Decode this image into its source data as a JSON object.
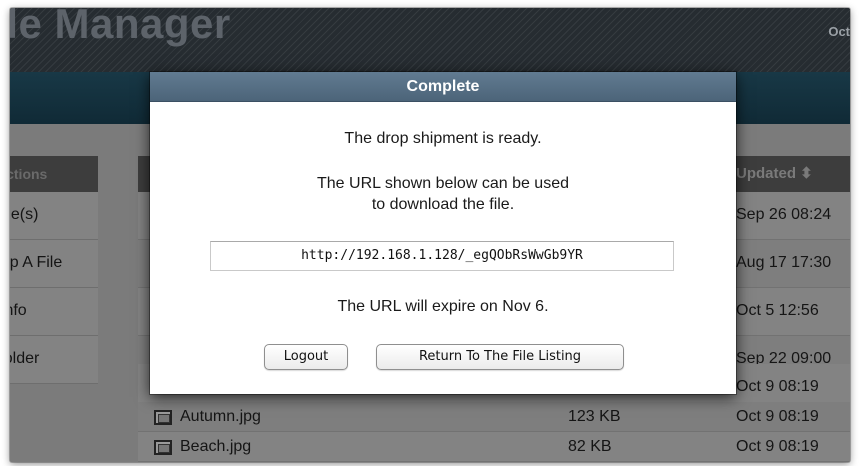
{
  "app": {
    "title": "File Manager",
    "date": "Oct"
  },
  "sidebar": {
    "header": "Actions",
    "items": [
      {
        "label": "File(s)"
      },
      {
        "label": "Drop A File"
      },
      {
        "label": "Info"
      },
      {
        "label": "Folder"
      }
    ]
  },
  "table": {
    "updated_header": "Updated ⬍",
    "rows": [
      {
        "name": "",
        "size": "",
        "updated": "Sep 26 08:24"
      },
      {
        "name": "",
        "size": "",
        "updated": "Aug 17 17:30"
      },
      {
        "name": "",
        "size": "",
        "updated": "Oct 5 12:56"
      },
      {
        "name": "",
        "size": "",
        "updated": "Sep 22 09:00"
      },
      {
        "name": "",
        "size": "",
        "updated": "Oct 9 08:19"
      },
      {
        "name": "Autumn.jpg",
        "size": "123 KB",
        "updated": "Oct 9 08:19",
        "icon": "image-icon"
      },
      {
        "name": "Beach.jpg",
        "size": "82 KB",
        "updated": "Oct 9 08:19",
        "icon": "image-icon"
      }
    ]
  },
  "modal": {
    "title": "Complete",
    "message_ready": "The drop shipment is ready.",
    "message_url_line1": "The URL shown below can be used",
    "message_url_line2": "to download the file.",
    "url": "http://192.168.1.128/_egQObRsWwGb9YR",
    "expiry": "The URL will expire on Nov 6.",
    "logout_label": "Logout",
    "return_label": "Return To The File Listing"
  }
}
